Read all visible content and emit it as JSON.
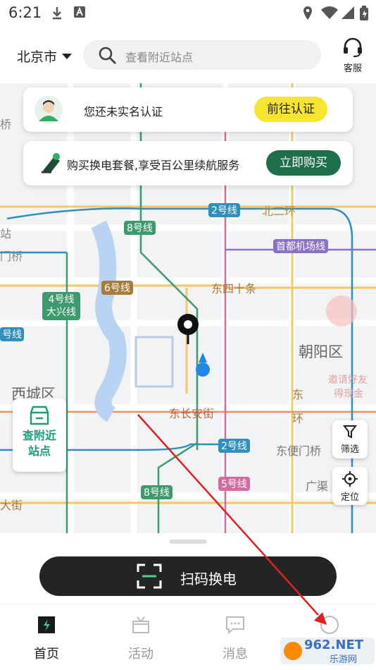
{
  "status": {
    "time": "6:21"
  },
  "header": {
    "city": "北京市",
    "search_placeholder": "查看附近站点",
    "service_label": "客服"
  },
  "banner_verify": {
    "text": "您还未实名认证",
    "button": "前往认证"
  },
  "banner_package": {
    "text": "购买换电套餐,享受百公里续航服务",
    "button": "立即购买"
  },
  "map": {
    "labels": {
      "line2_top": "2号线",
      "north2ring": "北二环",
      "line8_top": "8号线",
      "airport": "首都机场线",
      "line6": "6号线",
      "dongsi": "东四十条",
      "line4_a": "4号线",
      "line4_b": "大兴线",
      "chaoyang": "朝阳区",
      "xicheng": "西城区",
      "changan": "东长安街",
      "east_ring_a": "东",
      "east_ring_b": "环",
      "line2_bottom": "2号线",
      "dongbianmen": "东便门桥",
      "line8_bottom": "8号线",
      "line5": "5号线",
      "guangqu": "广渠",
      "daqie": "大街",
      "edge_qiao": "桥",
      "edge_zhan": "站",
      "edge_menqiao": "门桥",
      "edge_hao": "号线",
      "invite_a": "邀请好友",
      "invite_b": "得现金"
    },
    "nearby_button": {
      "line1": "查附近",
      "line2": "站点"
    },
    "filter_label": "筛选",
    "locate_label": "定位"
  },
  "scan_button": "扫码换电",
  "tabs": [
    {
      "label": "首页",
      "active": true
    },
    {
      "label": "活动",
      "active": false
    },
    {
      "label": "消息",
      "active": false
    },
    {
      "label": "",
      "active": false
    }
  ],
  "watermark": {
    "brand": "962.NET",
    "sub": "乐游网"
  },
  "colors": {
    "verify_button": "#f7e431",
    "package_button": "#1d6e4a",
    "scan_button": "#242424",
    "location_dot": "#1e88e5"
  }
}
